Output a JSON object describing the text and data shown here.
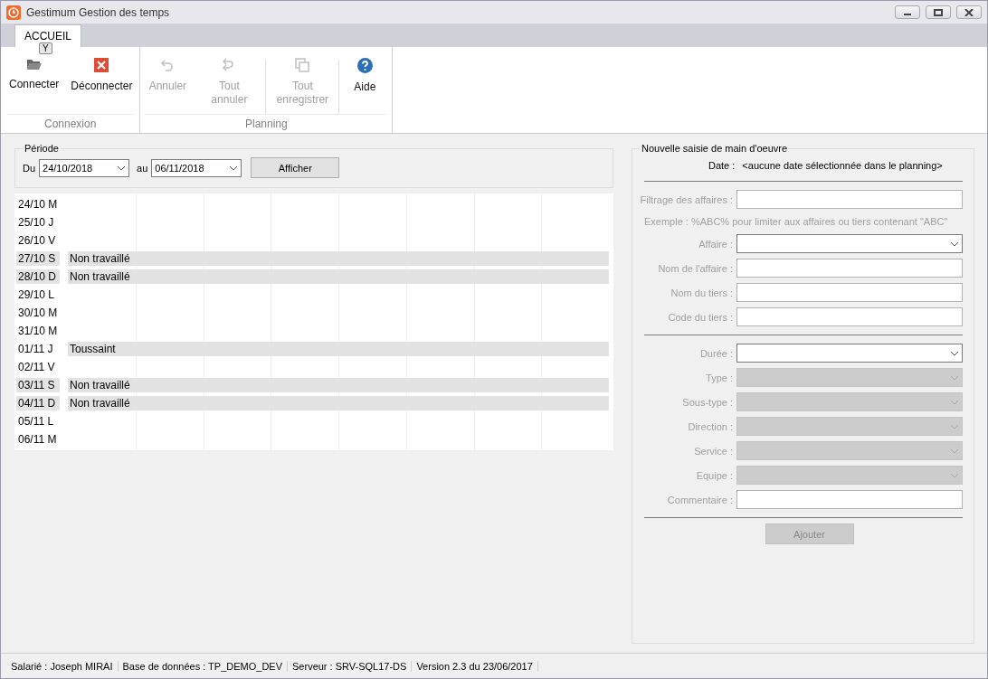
{
  "window": {
    "title": "Gestimum Gestion des temps"
  },
  "tabs": [
    {
      "label": "ACCUEIL",
      "selected": true,
      "keytip": "Y"
    }
  ],
  "ribbon": {
    "groups": [
      {
        "label": "Connexion",
        "items": [
          {
            "kind": "button",
            "label": "Connecter",
            "disabled": false
          },
          {
            "kind": "button",
            "label": "Déconnecter",
            "disabled": false
          }
        ]
      },
      {
        "label": "Planning",
        "items": [
          {
            "kind": "button",
            "label": "Annuler",
            "disabled": true
          },
          {
            "kind": "button",
            "label": "Tout annuler",
            "disabled": true
          },
          {
            "kind": "separator"
          },
          {
            "kind": "button",
            "label": "Tout enregistrer",
            "disabled": true
          },
          {
            "kind": "separator"
          },
          {
            "kind": "button",
            "label": "Aide",
            "disabled": false
          }
        ]
      }
    ]
  },
  "period": {
    "title": "Période",
    "from_label": "Du",
    "from": "24/10/2018",
    "to_label": "au",
    "to": "06/11/2018",
    "button": "Afficher"
  },
  "planning": {
    "rows": [
      {
        "date": "24/10 M",
        "weekend": false,
        "note": ""
      },
      {
        "date": "25/10 J",
        "weekend": false,
        "note": ""
      },
      {
        "date": "26/10 V",
        "weekend": false,
        "note": ""
      },
      {
        "date": "27/10 S",
        "weekend": true,
        "note": "Non travaillé"
      },
      {
        "date": "28/10 D",
        "weekend": true,
        "note": "Non travaillé"
      },
      {
        "date": "29/10 L",
        "weekend": false,
        "note": ""
      },
      {
        "date": "30/10 M",
        "weekend": false,
        "note": ""
      },
      {
        "date": "31/10 M",
        "weekend": false,
        "note": ""
      },
      {
        "date": "01/11 J",
        "weekend": false,
        "note": "Toussaint"
      },
      {
        "date": "02/11 V",
        "weekend": false,
        "note": ""
      },
      {
        "date": "03/11 S",
        "weekend": true,
        "note": "Non travaillé"
      },
      {
        "date": "04/11 D",
        "weekend": true,
        "note": "Non travaillé"
      },
      {
        "date": "05/11 L",
        "weekend": false,
        "note": ""
      },
      {
        "date": "06/11 M",
        "weekend": false,
        "note": ""
      }
    ]
  },
  "entry_form": {
    "title": "Nouvelle saisie de main d'oeuvre",
    "date_label": "Date :",
    "date_value": "<aucune date sélectionnée dans le planning>",
    "sections": [
      [
        {
          "kind": "text",
          "label": "Filtrage des affaires :",
          "disabled": false
        },
        {
          "kind": "hint",
          "label": "Exemple : %ABC% pour limiter aux affaires ou tiers contenant \"ABC\""
        },
        {
          "kind": "combo",
          "label": "Affaire :",
          "disabled": false
        },
        {
          "kind": "text",
          "label": "Nom de l'affaire :",
          "disabled": false
        },
        {
          "kind": "text",
          "label": "Nom du tiers :",
          "disabled": false
        },
        {
          "kind": "text",
          "label": "Code du tiers :",
          "disabled": false
        }
      ],
      [
        {
          "kind": "combo",
          "label": "Durée :",
          "disabled": false
        },
        {
          "kind": "combo",
          "label": "Type :",
          "disabled": true
        },
        {
          "kind": "combo",
          "label": "Sous-type :",
          "disabled": true
        },
        {
          "kind": "combo",
          "label": "Direction :",
          "disabled": true
        },
        {
          "kind": "combo",
          "label": "Service :",
          "disabled": true
        },
        {
          "kind": "combo",
          "label": "Equipe :",
          "disabled": true
        },
        {
          "kind": "text",
          "label": "Commentaire :",
          "disabled": false
        }
      ]
    ],
    "button": {
      "label": "Ajouter",
      "disabled": true
    }
  },
  "status_bar": [
    "Salarié : Joseph MIRAI",
    "Base de données : TP_DEMO_DEV",
    "Serveur : SRV-SQL17-DS",
    "Version 2.3 du 23/06/2017"
  ]
}
